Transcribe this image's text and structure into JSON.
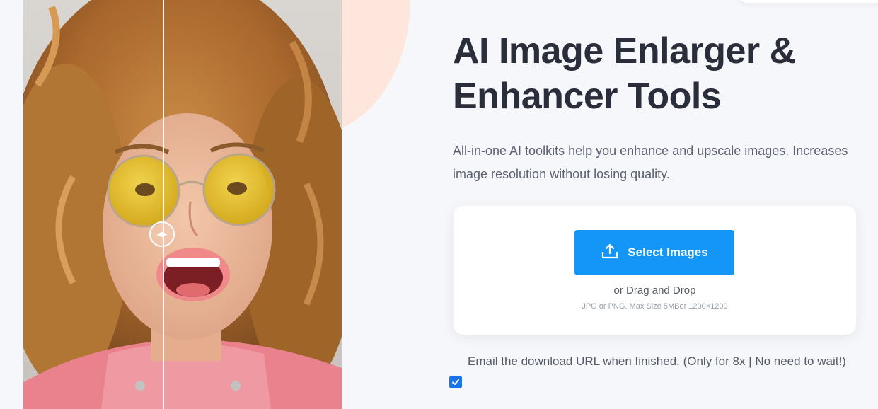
{
  "hero": {
    "title": "AI Image Enlarger & Enhancer Tools",
    "subtitle": "All-in-one AI toolkits help you enhance and upscale images. Increases image resolution without losing quality."
  },
  "upload": {
    "button_label": "Select Images",
    "button_icon": "upload-icon",
    "drag_text": "or Drag and Drop",
    "hint_text": "JPG or PNG. Max Size 5MBor 1200×1200"
  },
  "email_option": {
    "label": "Email the download URL when finished. (Only for 8x | No need to wait!)",
    "checked": true
  },
  "colors": {
    "accent": "#1396f7",
    "background": "#f6f7fa",
    "peach": "#ffe6dc",
    "title": "#2a2e3b"
  },
  "compare": {
    "handle_icon": "left-right-arrows-icon"
  }
}
